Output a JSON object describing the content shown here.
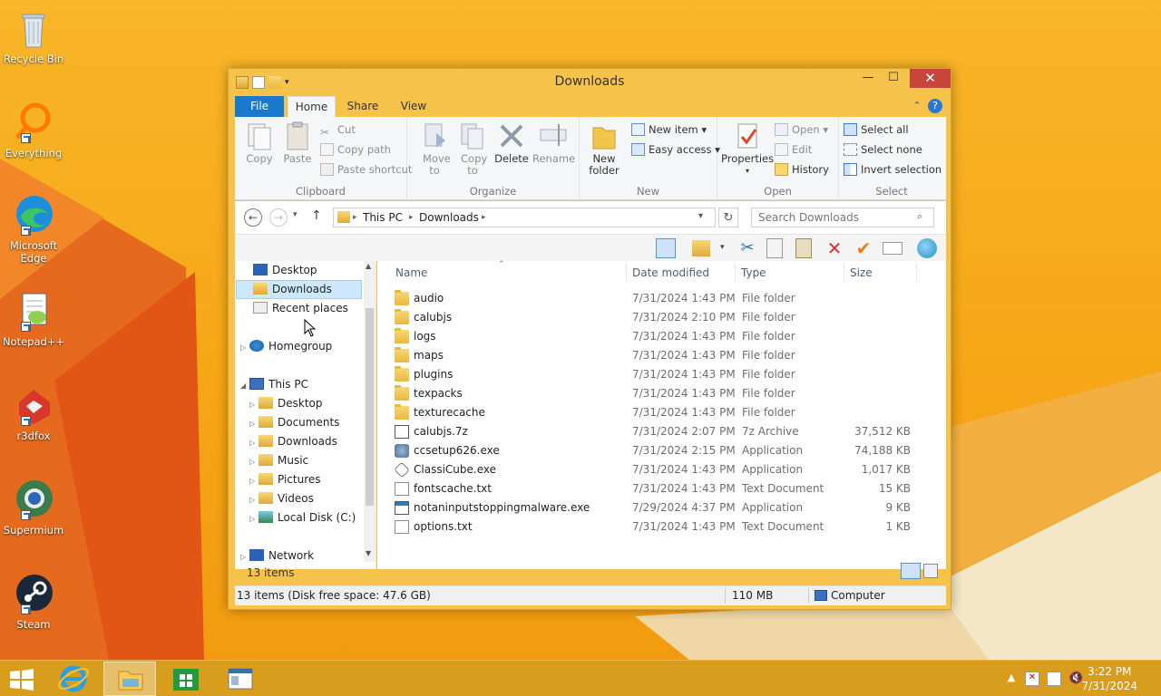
{
  "desktop": {
    "icons": [
      {
        "label": "Recycle Bin"
      },
      {
        "label": "Everything"
      },
      {
        "label": "Microsoft Edge"
      },
      {
        "label": "Notepad++"
      },
      {
        "label": "r3dfox"
      },
      {
        "label": "Supermium"
      },
      {
        "label": "Steam"
      }
    ]
  },
  "window": {
    "title": "Downloads",
    "controls": {
      "minimize": "—",
      "maximize": "☐",
      "close": "✕"
    }
  },
  "ribbon": {
    "tabs": [
      "File",
      "Home",
      "Share",
      "View"
    ],
    "help": "?",
    "collapse": "⌃",
    "clipboard": {
      "label": "Clipboard",
      "copy": "Copy",
      "paste": "Paste",
      "cut": "Cut",
      "copy_path": "Copy path",
      "paste_shortcut": "Paste shortcut"
    },
    "organize": {
      "label": "Organize",
      "move_to": "Move to",
      "copy_to": "Copy to",
      "delete": "Delete",
      "rename": "Rename"
    },
    "new": {
      "label": "New",
      "new_folder_line1": "New",
      "new_folder_line2": "folder",
      "new_item": "New item ▾",
      "easy_access": "Easy access ▾"
    },
    "open": {
      "label": "Open",
      "properties": "Properties",
      "open": "Open ▾",
      "edit": "Edit",
      "history": "History"
    },
    "select": {
      "label": "Select",
      "select_all": "Select all",
      "select_none": "Select none",
      "invert_selection": "Invert selection"
    }
  },
  "address": {
    "crumbs": [
      "This PC",
      "Downloads"
    ],
    "search_placeholder": "Search Downloads"
  },
  "navpane": {
    "items": [
      {
        "label": "Desktop"
      },
      {
        "label": "Downloads"
      },
      {
        "label": "Recent places"
      },
      {
        "label": "Homegroup"
      },
      {
        "label": "This PC"
      },
      {
        "label": "Desktop"
      },
      {
        "label": "Documents"
      },
      {
        "label": "Downloads"
      },
      {
        "label": "Music"
      },
      {
        "label": "Pictures"
      },
      {
        "label": "Videos"
      },
      {
        "label": "Local Disk (C:)"
      },
      {
        "label": "Network"
      }
    ]
  },
  "files": {
    "columns": [
      "Name",
      "Date modified",
      "Type",
      "Size"
    ],
    "rows": [
      {
        "name": "audio",
        "date": "7/31/2024 1:43 PM",
        "type": "File folder",
        "size": ""
      },
      {
        "name": "calubjs",
        "date": "7/31/2024 2:10 PM",
        "type": "File folder",
        "size": ""
      },
      {
        "name": "logs",
        "date": "7/31/2024 1:43 PM",
        "type": "File folder",
        "size": ""
      },
      {
        "name": "maps",
        "date": "7/31/2024 1:43 PM",
        "type": "File folder",
        "size": ""
      },
      {
        "name": "plugins",
        "date": "7/31/2024 1:43 PM",
        "type": "File folder",
        "size": ""
      },
      {
        "name": "texpacks",
        "date": "7/31/2024 1:43 PM",
        "type": "File folder",
        "size": ""
      },
      {
        "name": "texturecache",
        "date": "7/31/2024 1:43 PM",
        "type": "File folder",
        "size": ""
      },
      {
        "name": "calubjs.7z",
        "date": "7/31/2024 2:07 PM",
        "type": "7z Archive",
        "size": "37,512 KB"
      },
      {
        "name": "ccsetup626.exe",
        "date": "7/31/2024 2:15 PM",
        "type": "Application",
        "size": "74,188 KB"
      },
      {
        "name": "ClassiCube.exe",
        "date": "7/31/2024 1:43 PM",
        "type": "Application",
        "size": "1,017 KB"
      },
      {
        "name": "fontscache.txt",
        "date": "7/31/2024 1:43 PM",
        "type": "Text Document",
        "size": "15 KB"
      },
      {
        "name": "notaninputstoppingmalware.exe",
        "date": "7/29/2024 4:37 PM",
        "type": "Application",
        "size": "9 KB"
      },
      {
        "name": "options.txt",
        "date": "7/31/2024 1:43 PM",
        "type": "Text Document",
        "size": "1 KB"
      }
    ],
    "item_count": "13 items"
  },
  "statusbar": {
    "left": "13 items (Disk free space: 47.6 GB)",
    "size": "110 MB",
    "location": "Computer"
  },
  "taskbar": {
    "time": "3:22 PM",
    "date": "7/31/2024"
  }
}
